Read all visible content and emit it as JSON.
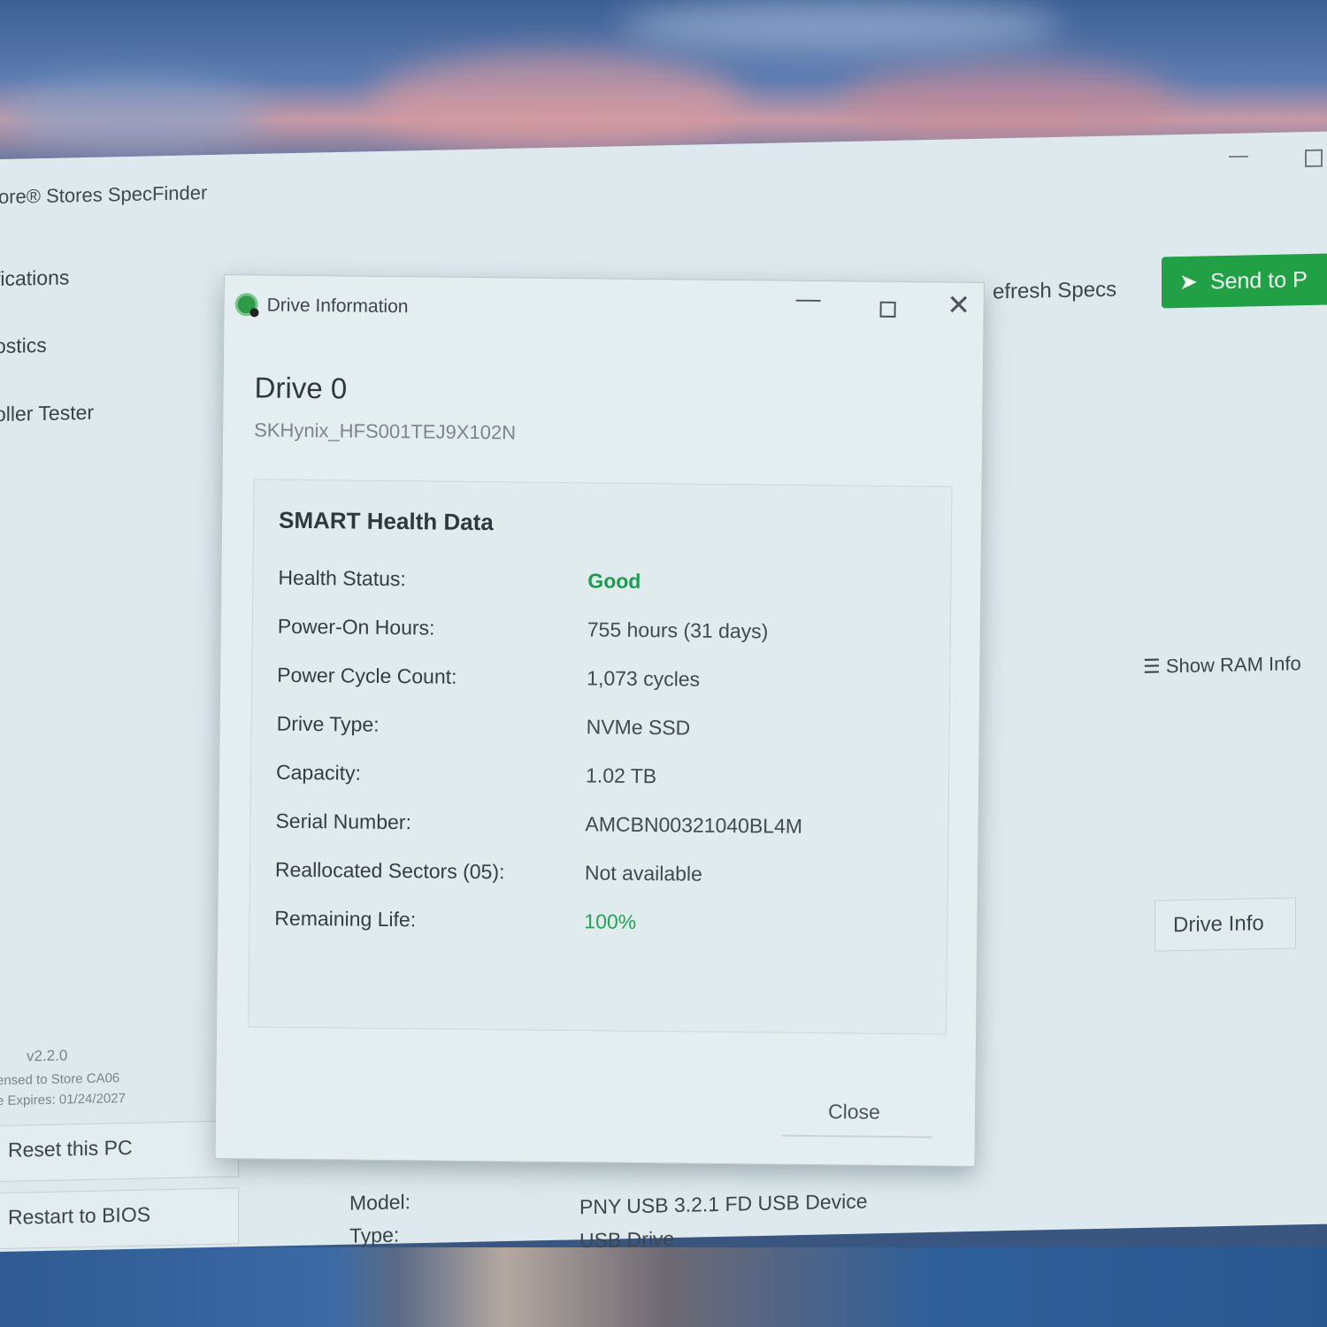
{
  "app": {
    "title": "ore® Stores SpecFinder",
    "window_controls": {
      "minimize": "—",
      "maximize": "□"
    }
  },
  "sidebar": {
    "items": [
      {
        "label": "fications"
      },
      {
        "label": "ostics"
      },
      {
        "label": "oller Tester"
      }
    ],
    "version": "v2.2.0",
    "license": "ensed to Store CA06",
    "expires": "e Expires: 01/24/2027",
    "buttons": [
      {
        "label": "Reset this PC"
      },
      {
        "label": "Restart to BIOS"
      }
    ]
  },
  "topbar": {
    "refresh_label": "efresh Specs",
    "send_label": "Send to P",
    "send_icon": "send-icon",
    "send_color": "#22a046"
  },
  "side_actions": {
    "show_ram_label": "Show RAM Info",
    "show_ram_icon": "list-icon",
    "drive_info_label": "Drive Info"
  },
  "bottom_fields": {
    "model_label": "Model:",
    "model_value": "PNY USB 3.2.1 FD USB Device",
    "type_label": "Type:",
    "type_value": "USB Drive"
  },
  "dialog": {
    "title": "Drive Information",
    "close_glyph": "✕",
    "min_glyph": "—",
    "drive_name": "Drive 0",
    "drive_model": "SKHynix_HFS001TEJ9X102N",
    "smart_title": "SMART Health Data",
    "rows": [
      {
        "label": "Health Status:",
        "value": "Good"
      },
      {
        "label": "Power-On Hours:",
        "value": "755 hours (31 days)"
      },
      {
        "label": "Power Cycle Count:",
        "value": "1,073 cycles"
      },
      {
        "label": "Drive Type:",
        "value": "NVMe SSD"
      },
      {
        "label": "Capacity:",
        "value": "1.02 TB"
      },
      {
        "label": "Serial Number:",
        "value": "AMCBN00321040BL4M"
      },
      {
        "label": "Reallocated Sectors (05):",
        "value": "Not available"
      },
      {
        "label": "Remaining Life:",
        "value": "100%"
      }
    ],
    "close_label": "Close",
    "good_color": "#1f9a50"
  }
}
